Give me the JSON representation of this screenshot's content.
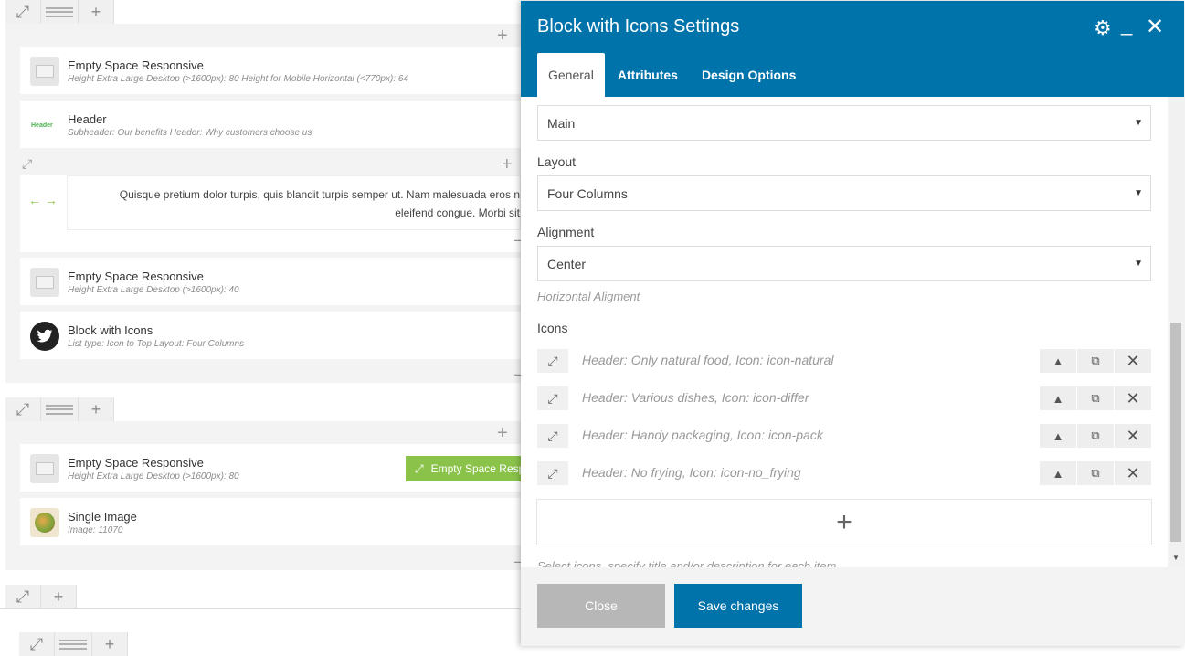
{
  "builder": {
    "elements": [
      {
        "title": "Empty Space Responsive",
        "sub": "Height Extra Large Desktop (>1600px): 80  Height for Mobile Horizontal (<770px): 64"
      },
      {
        "title": "Header",
        "sub": "Subheader: Our benefits  Header: Why customers choose us",
        "thumb_text": "Header"
      },
      {
        "title": "Empty Space Responsive",
        "sub": "Height Extra Large Desktop (>1600px): 40"
      },
      {
        "title": "Block with Icons",
        "sub": "List type: Icon to Top  Layout: Four Columns"
      },
      {
        "title": "Empty Space Responsive",
        "sub": "Height Extra Large Desktop (>1600px): 80"
      },
      {
        "title": "Single Image",
        "sub": "Image: 11070"
      }
    ],
    "text_block": "Quisque pretium dolor turpis, quis blandit turpis semper ut. Nam malesuada eros n eleifend congue. Morbi sit",
    "text_line1": "Quisque pretium dolor turpis, quis blandit turpis semper ut. Nam malesuada eros n",
    "text_line2": "eleifend congue. Morbi sit",
    "drag_label": "Empty Space Respo"
  },
  "modal": {
    "title": "Block with Icons Settings",
    "tabs": [
      "General",
      "Attributes",
      "Design Options"
    ],
    "active_tab": "General",
    "fields": {
      "first_select_value": "Main",
      "layout_label": "Layout",
      "layout_value": "Four Columns",
      "alignment_label": "Alignment",
      "alignment_value": "Center",
      "alignment_hint": "Horizontal Aligment",
      "icons_label": "Icons",
      "icons": [
        "Header: Only natural food, Icon: icon-natural",
        "Header: Various dishes, Icon: icon-differ",
        "Header: Handy packaging, Icon: icon-pack",
        "Header: No frying, Icon: icon-no_frying"
      ],
      "icons_hint": "Select icons, specify title and/or description for each item"
    },
    "footer": {
      "close_label": "Close",
      "save_label": "Save changes"
    }
  },
  "colors": {
    "header_bg": "#0073aa",
    "save_bg": "#0073aa",
    "close_bg": "#b7b7b7",
    "accent_green": "#8bc34a"
  }
}
